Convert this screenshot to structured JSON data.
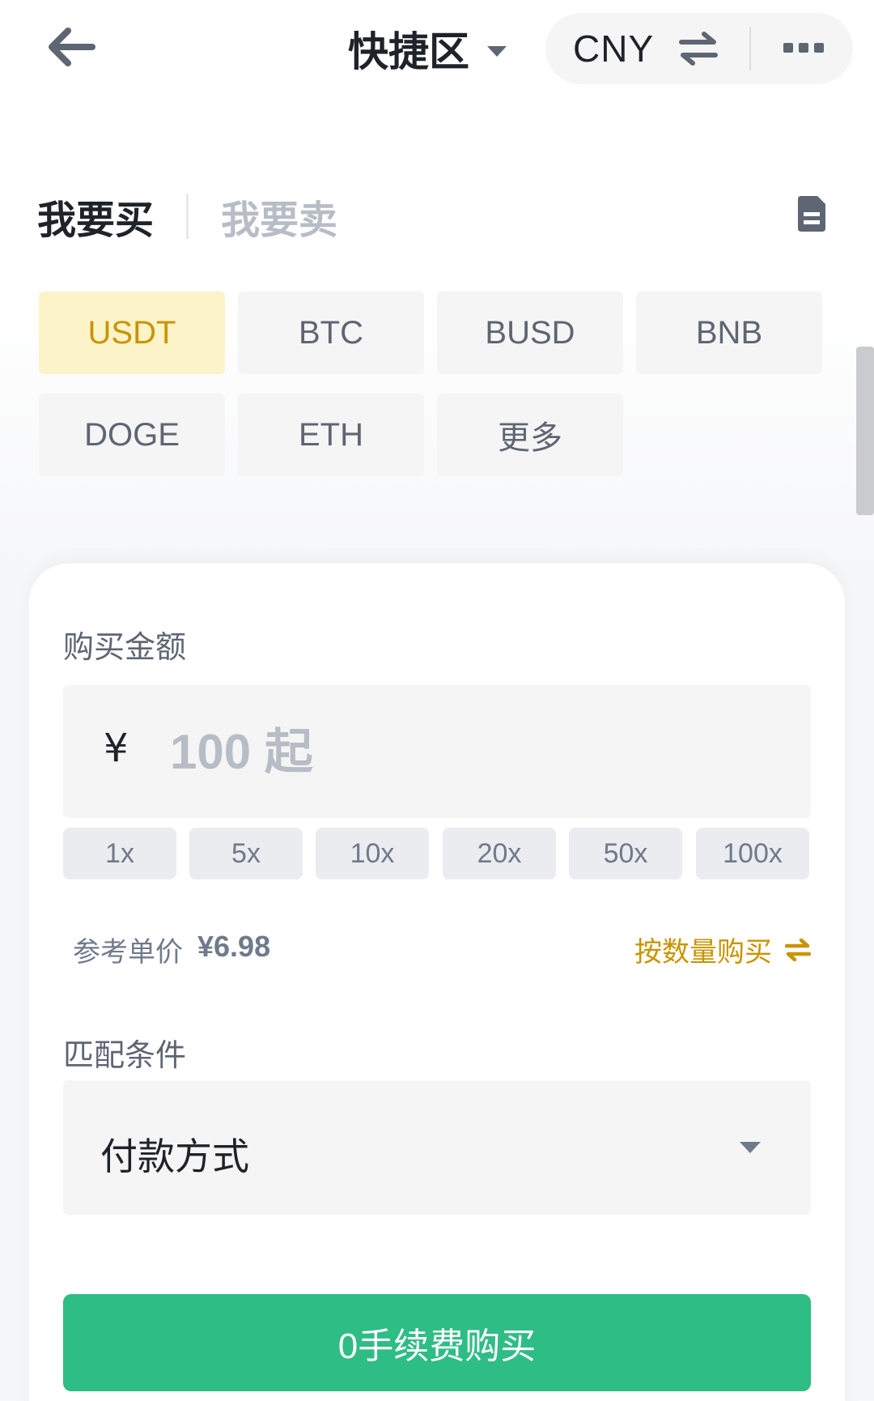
{
  "header": {
    "title": "快捷区",
    "currency": "CNY"
  },
  "tabs": {
    "buy": "我要买",
    "sell": "我要卖"
  },
  "coins": [
    {
      "label": "USDT",
      "active": true
    },
    {
      "label": "BTC",
      "active": false
    },
    {
      "label": "BUSD",
      "active": false
    },
    {
      "label": "BNB",
      "active": false
    },
    {
      "label": "DOGE",
      "active": false
    },
    {
      "label": "ETH",
      "active": false
    },
    {
      "label": "更多",
      "active": false
    }
  ],
  "amount": {
    "label": "购买金额",
    "currency_symbol": "¥",
    "placeholder": "100 起",
    "value": ""
  },
  "multipliers": [
    "1x",
    "5x",
    "10x",
    "20x",
    "50x",
    "100x"
  ],
  "price": {
    "label": "参考单价",
    "value": "¥6.98",
    "switch_label": "按数量购买"
  },
  "match": {
    "label": "匹配条件",
    "payment_method": "付款方式"
  },
  "submit_label": "0手续费购买",
  "colors": {
    "accent": "#c99400",
    "active_bg": "#fdf3c8",
    "buy_green": "#2ebd85"
  }
}
